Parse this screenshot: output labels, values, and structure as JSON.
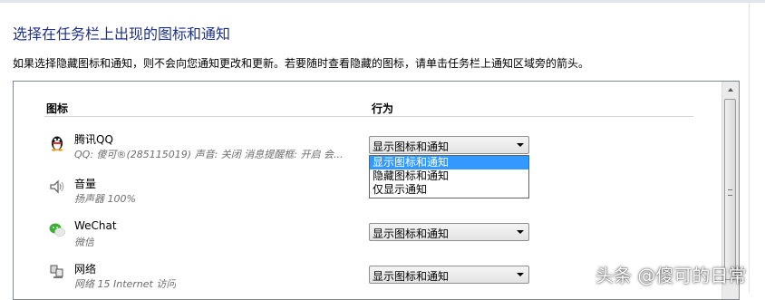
{
  "header": {
    "title": "选择在任务栏上出现的图标和通知",
    "intro": "如果选择隐藏图标和通知，则不会向您通知更改和更新。若要随时查看隐藏的图标，请单击任务栏上通知区域旁的箭头。"
  },
  "table": {
    "col_icon": "图标",
    "col_behavior": "行为"
  },
  "rows": [
    {
      "name": "腾讯QQ",
      "desc": "QQ: 傻可®(285115019)  声音: 关闭  消息提醒框: 开启  会...",
      "behavior": "显示图标和通知",
      "icon": "qq-penguin-icon"
    },
    {
      "name": "音量",
      "desc": "扬声器 100%",
      "behavior": "",
      "icon": "speaker-icon"
    },
    {
      "name": "WeChat",
      "desc": "微信",
      "behavior": "显示图标和通知",
      "icon": "wechat-icon"
    },
    {
      "name": "网络",
      "desc": "网络 15 Internet 访问",
      "behavior": "显示图标和通知",
      "icon": "network-icon"
    }
  ],
  "dropdown": {
    "options": [
      "显示图标和通知",
      "隐藏图标和通知",
      "仅显示通知"
    ],
    "selected_index": 0
  },
  "watermark": "头条 @傻可的日常",
  "colors": {
    "title": "#1e3287",
    "selection": "#3399ff"
  }
}
